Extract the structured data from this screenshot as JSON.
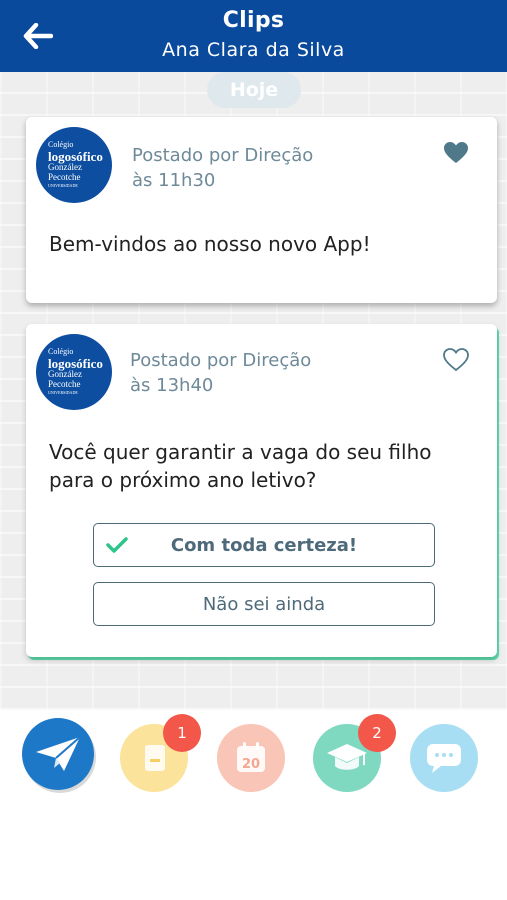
{
  "header": {
    "title": "Clips",
    "subtitle": "Ana Clara da Silva"
  },
  "feed": {
    "day_label": "Hoje",
    "posts": [
      {
        "logo": {
          "line1": "Colégio",
          "line2": "logosófico",
          "line3": "González",
          "line4": "Pecotche",
          "line5": "UNIVERSIDADE"
        },
        "posted_by": "Postado por Direção",
        "time": "às 11h30",
        "message": "Bem-vindos ao nosso novo App!",
        "liked": true
      },
      {
        "logo": {
          "line1": "Colégio",
          "line2": "logosófico",
          "line3": "González",
          "line4": "Pecotche",
          "line5": "UNIVERSIDADE"
        },
        "posted_by": "Postado por Direção",
        "time": "às 13h40",
        "message_line1": "Você quer garantir a vaga do seu filho",
        "message_line2": "para o próximo ano letivo?",
        "liked": false,
        "options": [
          {
            "label": "Com toda certeza!",
            "selected": true
          },
          {
            "label": "Não sei ainda",
            "selected": false
          }
        ]
      }
    ]
  },
  "tabbar": {
    "tabs": [
      {
        "icon": "paper-plane-icon",
        "badge": ""
      },
      {
        "icon": "notebook-icon",
        "badge": "1"
      },
      {
        "icon": "calendar-icon",
        "badge": "",
        "calendar_day": "20"
      },
      {
        "icon": "graduation-cap-icon",
        "badge": "2"
      },
      {
        "icon": "chat-bubble-icon",
        "badge": ""
      }
    ]
  },
  "colors": {
    "header_bg": "#0a4a9c",
    "accent_green": "#5fe0b0",
    "badge_red": "#f2574a",
    "text_muted": "#6e8a99"
  }
}
